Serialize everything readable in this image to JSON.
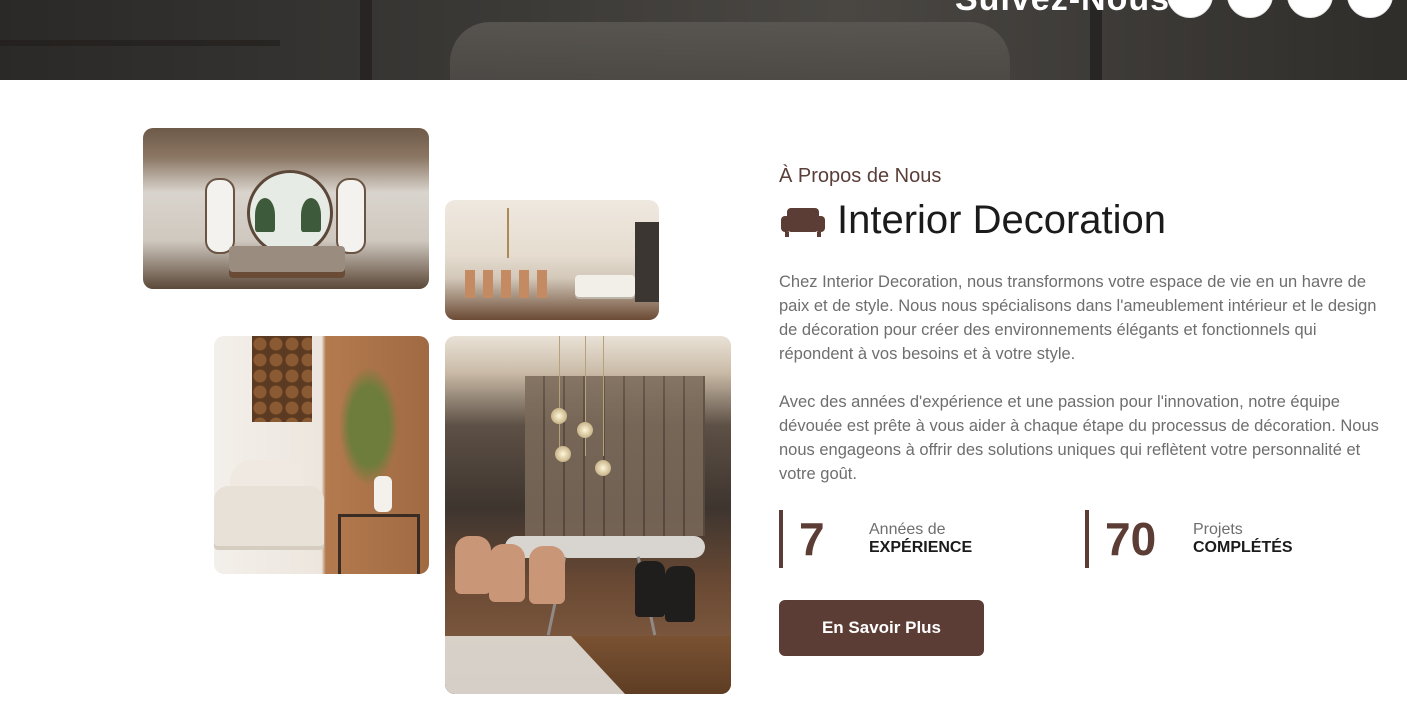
{
  "hero": {
    "title_fragment": "Suivez-Nous :",
    "social": [
      {
        "icon": "facebook-icon"
      },
      {
        "icon": "twitter-icon"
      },
      {
        "icon": "instagram-icon"
      },
      {
        "icon": "linkedin-icon"
      }
    ]
  },
  "about": {
    "eyebrow": "À Propos de Nous",
    "icon": "sofa-icon",
    "title": "Interior Decoration",
    "paragraph1": "Chez Interior Decoration, nous transformons votre espace de vie en un havre de paix et de style. Nous nous spécialisons dans l'ameublement intérieur et le design de décoration pour créer des environnements élégants et fonctionnels qui répondent à vos besoins et à votre style.",
    "paragraph2": "Avec des années d'expérience et une passion pour l'innovation, notre équipe dévouée est prête à vous aider à chaque étape du processus de décoration. Nous nous engageons à offrir des solutions uniques qui reflètent votre personnalité et votre goût.",
    "stats": [
      {
        "value": "7",
        "label_top": "Années de",
        "label_bottom": "EXPÉRIENCE"
      },
      {
        "value": "70",
        "label_top": "Projets",
        "label_bottom": "COMPLÉTÉS"
      }
    ],
    "cta_label": "En Savoir Plus"
  },
  "colors": {
    "accent": "#5c3d35",
    "text_muted": "#6e6e6e",
    "heading": "#1b1b1b"
  }
}
